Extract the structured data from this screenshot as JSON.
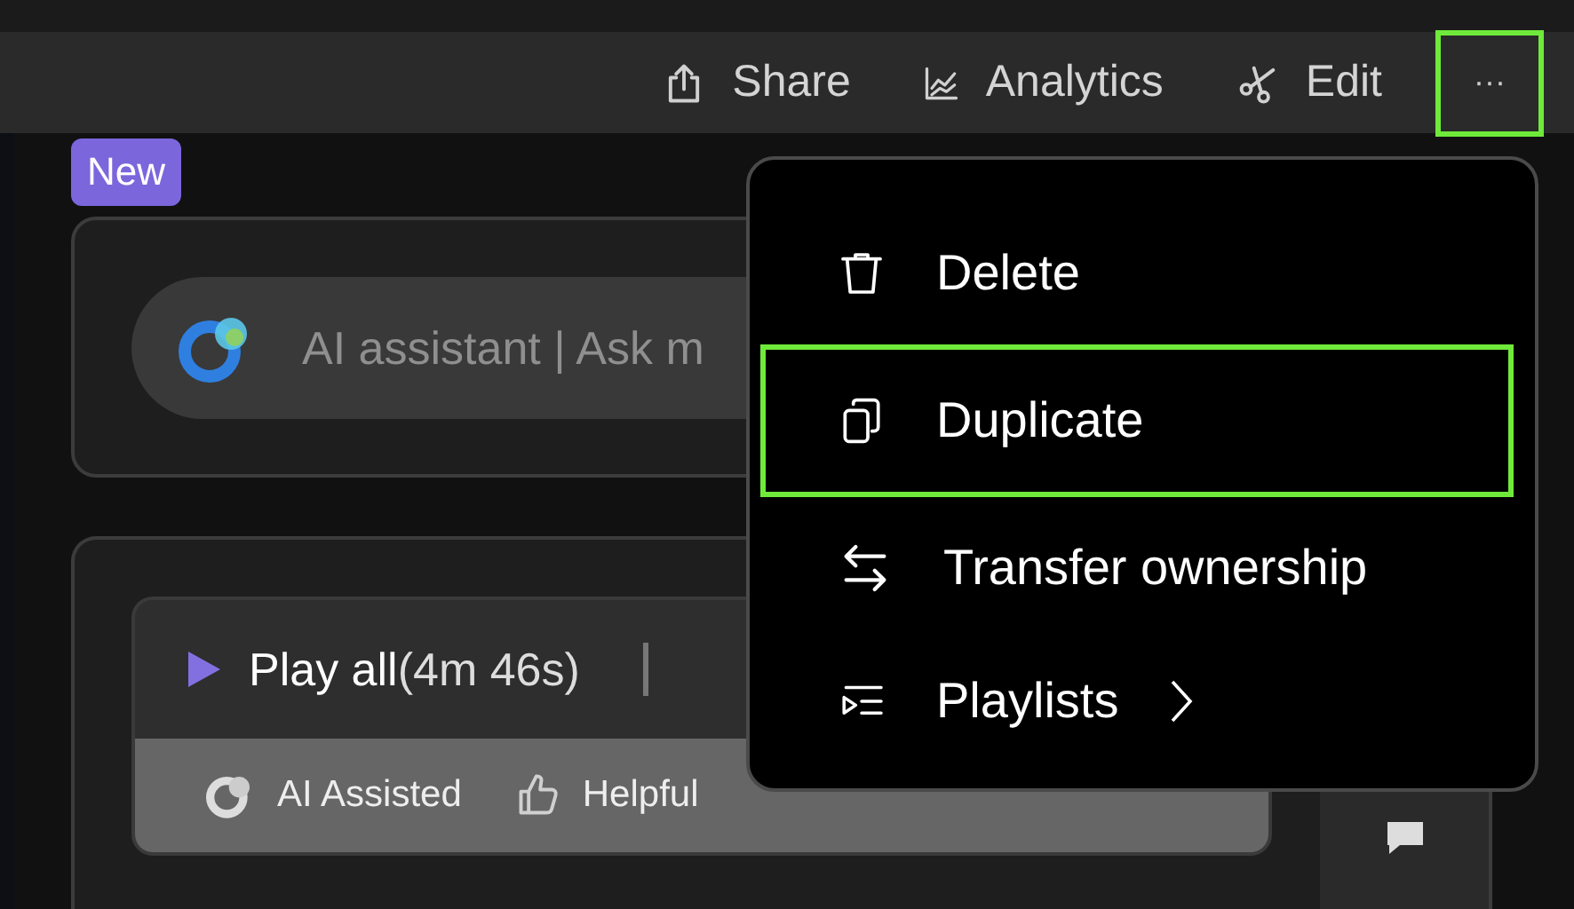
{
  "toolbar": {
    "actions": [
      {
        "kind": "share",
        "label": "Share"
      },
      {
        "kind": "analytics",
        "label": "Analytics"
      },
      {
        "kind": "edit",
        "label": "Edit"
      }
    ],
    "more": {
      "label": "···",
      "highlighted": true
    }
  },
  "badge": "New",
  "assistant": {
    "placeholder": "AI assistant | Ask m"
  },
  "player": {
    "play": "Play all",
    "duration": "(4m 46s)",
    "feedback": [
      {
        "kind": "ai",
        "label": "AI Assisted"
      },
      {
        "kind": "helpful",
        "label": "Helpful"
      }
    ]
  },
  "menu": {
    "items": [
      {
        "kind": "delete",
        "label": "Delete",
        "highlighted": false,
        "submenu": false
      },
      {
        "kind": "duplicate",
        "label": "Duplicate",
        "highlighted": true,
        "submenu": false
      },
      {
        "kind": "transfer",
        "label": "Transfer ownership",
        "highlighted": false,
        "submenu": false
      },
      {
        "kind": "playlists",
        "label": "Playlists",
        "highlighted": false,
        "submenu": true
      }
    ]
  }
}
